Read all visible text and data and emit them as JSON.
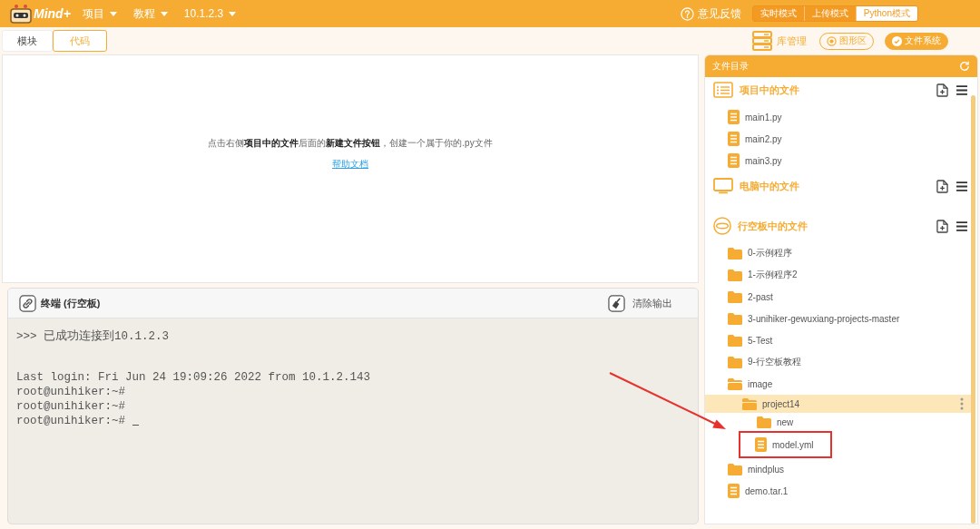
{
  "header": {
    "logo": "Mind+",
    "menus": [
      {
        "label": "项目"
      },
      {
        "label": "教程"
      },
      {
        "label": "10.1.2.3"
      }
    ],
    "feedback": "意见反馈",
    "modes": [
      {
        "label": "实时模式",
        "selected": false
      },
      {
        "label": "上传模式",
        "selected": false
      },
      {
        "label": "Python模式",
        "selected": true
      }
    ]
  },
  "tabs": [
    {
      "label": "模块",
      "selected": false
    },
    {
      "label": "代码",
      "selected": true
    }
  ],
  "toolbar": {
    "library": "库管理",
    "views": [
      {
        "label": "图形区",
        "selected": false
      },
      {
        "label": "文件系统",
        "selected": true
      }
    ]
  },
  "editor": {
    "hint": "点击右侧**项目中的文件**后面的**新建文件按钮**，创建一个属于你的.py文件",
    "help_link": "帮助文档"
  },
  "terminal": {
    "title": "终端 (行空板)",
    "clear_button": "清除输出",
    "blocks": [
      [
        ">>> 已成功连接到10.1.2.3"
      ],
      [
        "Last login: Fri Jun 24 19:09:26 2022 from 10.1.2.143",
        "root@unihiker:~#",
        "root@unihiker:~#",
        "root@unihiker:~#"
      ]
    ],
    "cursor": true
  },
  "file_panel": {
    "title": "文件目录",
    "sections": [
      {
        "kind": "project",
        "title": "项目中的文件",
        "items": [
          {
            "kind": "file",
            "name": "main1.py",
            "selected": false,
            "annotated": false
          },
          {
            "kind": "file",
            "name": "main2.py",
            "selected": false,
            "annotated": false
          },
          {
            "kind": "file",
            "name": "main3.py",
            "selected": false,
            "annotated": false
          }
        ]
      },
      {
        "kind": "computer",
        "title": "电脑中的文件"
      },
      {
        "kind": "board",
        "title": "行空板中的文件",
        "items": [
          {
            "kind": "folder",
            "name": "0-示例程序",
            "expanded": false,
            "selected": false,
            "annotated": false
          },
          {
            "kind": "folder",
            "name": "1-示例程序2",
            "expanded": false,
            "selected": false,
            "annotated": false
          },
          {
            "kind": "folder",
            "name": "2-past",
            "expanded": false,
            "selected": false,
            "annotated": false
          },
          {
            "kind": "folder",
            "name": "3-unihiker-gewuxiang-projects-master",
            "expanded": false,
            "selected": false,
            "annotated": false
          },
          {
            "kind": "folder",
            "name": "5-Test",
            "expanded": false,
            "selected": false,
            "annotated": false
          },
          {
            "kind": "folder",
            "name": "9-行空板教程",
            "expanded": false,
            "selected": false,
            "annotated": false
          },
          {
            "kind": "folder",
            "name": "image",
            "expanded": true,
            "selected": false,
            "annotated": false,
            "children": [
              {
                "kind": "folder",
                "name": "project14",
                "expanded": true,
                "selected": true,
                "annotated": false,
                "children": [
                  {
                    "kind": "folder",
                    "name": "new",
                    "expanded": false,
                    "selected": false,
                    "annotated": false
                  },
                  {
                    "kind": "file",
                    "name": "model.yml",
                    "selected": false,
                    "annotated": true
                  }
                ]
              }
            ]
          },
          {
            "kind": "folder",
            "name": "mindplus",
            "expanded": false,
            "selected": false,
            "annotated": false
          },
          {
            "kind": "file",
            "name": "demo.tar.1",
            "selected": false,
            "annotated": false
          }
        ]
      }
    ]
  }
}
